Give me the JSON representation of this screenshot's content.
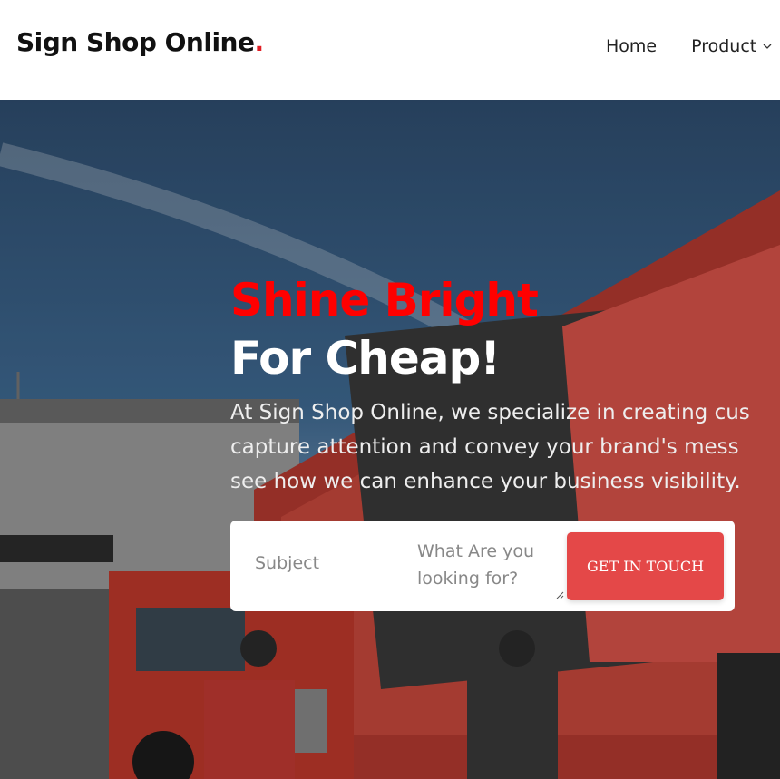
{
  "header": {
    "brand": "Sign Shop Online",
    "brand_dot": ".",
    "nav": [
      {
        "label": "Home"
      },
      {
        "label": "Product",
        "icon": "chevron-down-icon"
      }
    ]
  },
  "hero": {
    "heading_red": "Shine Bright",
    "heading_white": "For Cheap!",
    "paragraph_lines": [
      "At Sign Shop Online, we specialize in creating cus",
      "capture attention and convey your brand's mess",
      "see how we can enhance your business visibility."
    ],
    "form": {
      "subject_placeholder": "Subject",
      "looking_placeholder": "What Are you looking for?",
      "button": "GET IN TOUCH"
    }
  },
  "colors": {
    "accent_red": "#ff0000",
    "button": "#e44848",
    "brand_dot": "#e11d24"
  }
}
